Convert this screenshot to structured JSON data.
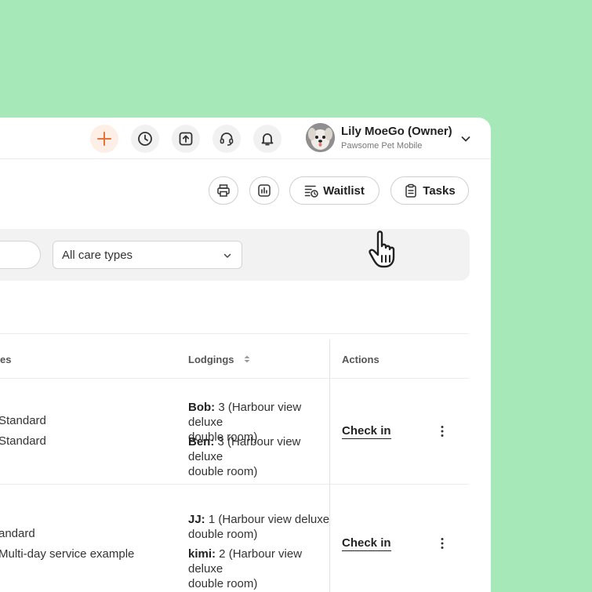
{
  "header": {
    "user_name": "Lily MoeGo (Owner)",
    "user_org": "Pawsome Pet Mobile",
    "accent_color": "#e8733a"
  },
  "toolbar": {
    "waitlist_label": "Waitlist",
    "tasks_label": "Tasks"
  },
  "filters": {
    "care_type_selected": "All care types"
  },
  "table": {
    "columns": {
      "services_fragment": "es",
      "lodgings": "Lodgings",
      "actions": "Actions"
    },
    "rows": [
      {
        "services": [
          "Standard",
          "Standard"
        ],
        "lodgings": [
          {
            "pet": "Bob:",
            "line1": " 3 (Harbour view deluxe",
            "line2": "double room)"
          },
          {
            "pet": "Ben:",
            "line1": " 3 (Harbour view deluxe",
            "line2": "double room)"
          }
        ],
        "action": "Check in"
      },
      {
        "services": [
          "andard",
          "Multi-day service example"
        ],
        "lodgings": [
          {
            "pet": "JJ:",
            "line1": " 1 (Harbour view deluxe",
            "line2": "double room)"
          },
          {
            "pet": "kimi:",
            "line1": " 2 (Harbour view deluxe",
            "line2": "double room)"
          }
        ],
        "action": "Check in"
      }
    ]
  }
}
